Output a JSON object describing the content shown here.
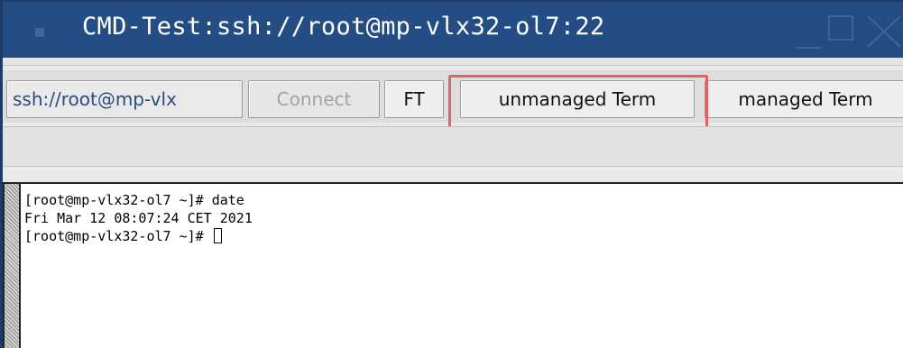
{
  "window": {
    "title": "CMD-Test:ssh://root@mp-vlx32-ol7:22",
    "title_color": "#244d85"
  },
  "toolbar": {
    "url_value": "ssh://root@mp-vlx",
    "connect_label": "Connect",
    "ft_label": "FT",
    "unmanaged_label": "unmanaged Term",
    "managed_label": "managed Term",
    "highlight_color": "#e06464"
  },
  "terminal": {
    "lines": [
      "[root@mp-vlx32-ol7 ~]# date",
      "Fri Mar 12 08:07:24 CET 2021",
      "[root@mp-vlx32-ol7 ~]# "
    ]
  }
}
